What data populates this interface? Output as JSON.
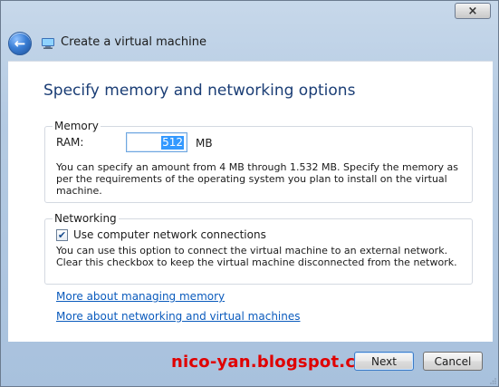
{
  "window": {
    "title": "Create a virtual machine",
    "close_glyph": "×"
  },
  "icons": {
    "back": "back-arrow-icon",
    "app": "virtual-machine-icon",
    "close": "close-icon",
    "checkbox": "checkbox-icon"
  },
  "page": {
    "heading": "Specify memory and networking options"
  },
  "memory": {
    "legend": "Memory",
    "ram_label": "RAM:",
    "ram_value": "512",
    "ram_unit": "MB",
    "description": "You can specify an amount from 4 MB through 1.532 MB. Specify the memory as per the requirements of the operating system you plan to install on the virtual machine."
  },
  "networking": {
    "legend": "Networking",
    "checkbox_label": "Use computer network connections",
    "checkbox_checked": true,
    "description": "You can use this option to connect the virtual machine to an external network. Clear this checkbox to keep the virtual machine disconnected from the network."
  },
  "links": {
    "memory": "More about managing memory",
    "networking": "More about networking and virtual machines"
  },
  "watermark": "nico-yan.blogspot.com",
  "buttons": {
    "next": "Next",
    "cancel": "Cancel"
  },
  "colors": {
    "heading": "#1a3d75",
    "link": "#0b5bbd",
    "watermark": "#e00000",
    "selection": "#3399ff"
  }
}
